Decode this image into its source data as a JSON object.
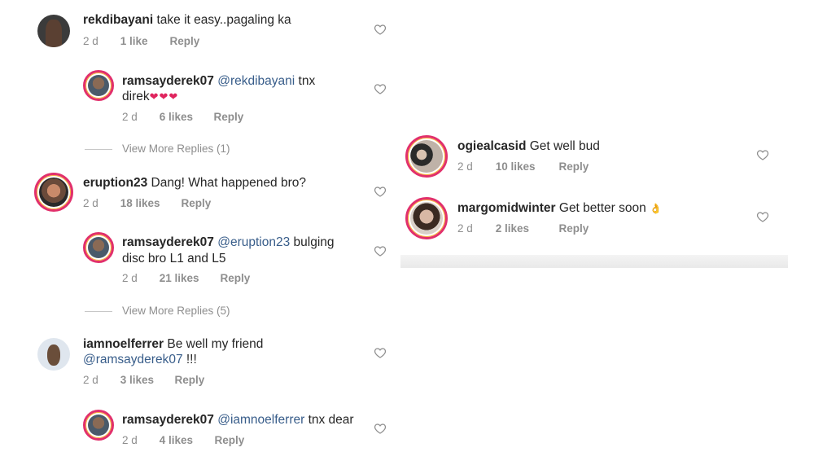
{
  "left_comments": [
    {
      "user": "rekdibayani",
      "text": " take it easy..pagaling ka",
      "line2": "",
      "time": "2 d",
      "likes": "1 like",
      "reply": "Reply"
    },
    {
      "user": "ramsayderek07",
      "mention": " @rekdibayani",
      "text": " tnx",
      "line2": "direk",
      "hearts": "❤❤❤",
      "time": "2 d",
      "likes": "6 likes",
      "reply": "Reply"
    },
    {
      "view_more": "View More Replies (1)"
    },
    {
      "user": "eruption23",
      "text": " Dang! What happened bro?",
      "time": "2 d",
      "likes": "18 likes",
      "reply": "Reply"
    },
    {
      "user": "ramsayderek07",
      "mention": " @eruption23",
      "text": " bulging",
      "line2": "disc bro L1 and L5",
      "time": "2 d",
      "likes": "21 likes",
      "reply": "Reply"
    },
    {
      "view_more": "View More Replies (5)"
    },
    {
      "user": "iamnoelferrer",
      "text": " Be well my friend",
      "line2_mention": "@ramsayderek07",
      "line2_text": " !!!",
      "time": "2 d",
      "likes": "3 likes",
      "reply": "Reply"
    },
    {
      "user": "ramsayderek07",
      "mention": " @iamnoelferrer",
      "text": " tnx dear",
      "time": "2 d",
      "likes": "4 likes",
      "reply": "Reply"
    }
  ],
  "right_comments": [
    {
      "user": "ogiealcasid",
      "text": " Get well bud",
      "time": "2 d",
      "likes": "10 likes",
      "reply": "Reply"
    },
    {
      "user": "margomidwinter",
      "text": " Get better soon ",
      "emoji": "👌",
      "time": "2 d",
      "likes": "2 likes",
      "reply": "Reply"
    }
  ],
  "colors": {
    "username": "#262626",
    "mention": "#385d8a",
    "meta": "#8e8e8e",
    "story_ring": "#e1306c"
  },
  "icons": {
    "like": "heart-outline-icon"
  }
}
